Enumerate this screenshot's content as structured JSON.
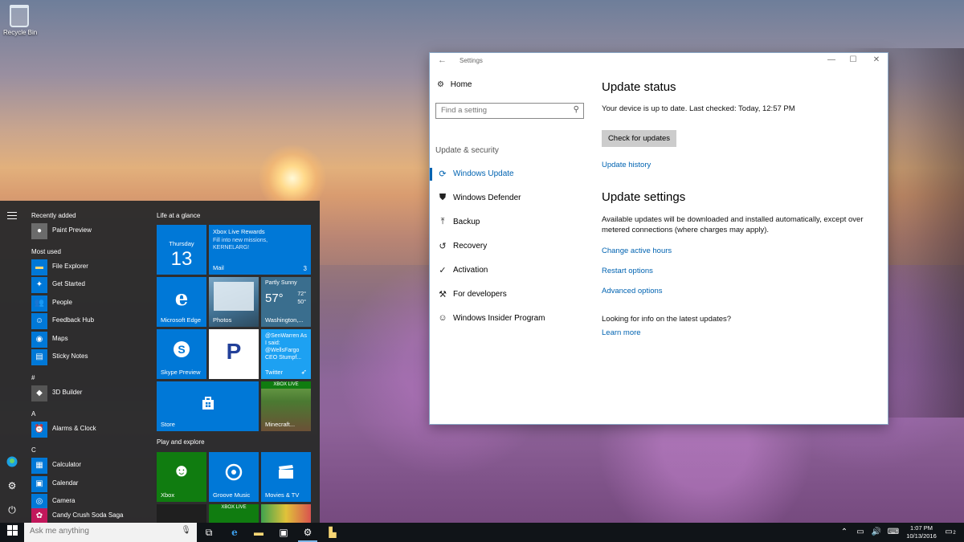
{
  "desktop": {
    "recycle_bin_label": "Recycle Bin"
  },
  "start_menu": {
    "recently_added_header": "Recently added",
    "recently_added": [
      {
        "name": "Paint Preview",
        "icon": "paint-icon"
      }
    ],
    "most_used_header": "Most used",
    "most_used": [
      {
        "name": "File Explorer",
        "icon": "folder-icon"
      },
      {
        "name": "Get Started",
        "icon": "lightbulb-icon"
      },
      {
        "name": "People",
        "icon": "people-icon"
      },
      {
        "name": "Feedback Hub",
        "icon": "feedback-icon"
      },
      {
        "name": "Maps",
        "icon": "map-icon"
      },
      {
        "name": "Sticky Notes",
        "icon": "note-icon"
      }
    ],
    "sections": [
      {
        "letter": "#",
        "apps": [
          {
            "name": "3D Builder",
            "icon": "cube-icon"
          }
        ]
      },
      {
        "letter": "A",
        "apps": [
          {
            "name": "Alarms & Clock",
            "icon": "alarm-icon"
          }
        ]
      },
      {
        "letter": "C",
        "apps": [
          {
            "name": "Calculator",
            "icon": "calculator-icon"
          },
          {
            "name": "Calendar",
            "icon": "calendar-icon"
          },
          {
            "name": "Camera",
            "icon": "camera-icon"
          },
          {
            "name": "Candy Crush Soda Saga",
            "icon": "candy-icon"
          }
        ]
      }
    ],
    "group_life": "Life at a glance",
    "group_play": "Play and explore",
    "tiles": {
      "calendar_day": "Thursday",
      "calendar_date": "13",
      "mail_title": "Xbox Live Rewards",
      "mail_body": "Fill into new missions, KERNELARG!",
      "mail_label": "Mail",
      "mail_count": "3",
      "edge_label": "Microsoft Edge",
      "photos_label": "Photos",
      "weather_cond": "Partly Sunny",
      "weather_temp": "57°",
      "weather_high": "72°",
      "weather_low": "50°",
      "weather_city": "Washington,...",
      "twitter_text": "@SenWarren As I said: @WellsFargo CEO Stumpf...",
      "twitter_label": "Twitter",
      "skype_label": "Skype Preview",
      "store_label": "Store",
      "minecraft_label": "Minecraft...",
      "xbox_live_badge": "XBOX LIVE",
      "xbox_label": "Xbox",
      "groove_label": "Groove Music",
      "movies_label": "Movies & TV"
    }
  },
  "settings": {
    "window_title": "Settings",
    "home": "Home",
    "search_placeholder": "Find a setting",
    "group_label": "Update & security",
    "nav": [
      {
        "label": "Windows Update",
        "icon": "refresh-icon",
        "active": true
      },
      {
        "label": "Windows Defender",
        "icon": "shield-icon",
        "active": false
      },
      {
        "label": "Backup",
        "icon": "backup-arrow-icon",
        "active": false
      },
      {
        "label": "Recovery",
        "icon": "history-icon",
        "active": false
      },
      {
        "label": "Activation",
        "icon": "check-circle-icon",
        "active": false
      },
      {
        "label": "For developers",
        "icon": "developer-icon",
        "active": false
      },
      {
        "label": "Windows Insider Program",
        "icon": "person-icon",
        "active": false
      }
    ],
    "update_status_heading": "Update status",
    "status_text": "Your device is up to date. Last checked: Today, 12:57 PM",
    "check_button": "Check for updates",
    "update_history_link": "Update history",
    "update_settings_heading": "Update settings",
    "settings_text": "Available updates will be downloaded and installed automatically, except over metered connections (where charges may apply).",
    "change_active_hours": "Change active hours",
    "restart_options": "Restart options",
    "advanced_options": "Advanced options",
    "info_question": "Looking for info on the latest updates?",
    "learn_more": "Learn more"
  },
  "taskbar": {
    "search_placeholder": "Ask me anything",
    "time": "1:07 PM",
    "date": "10/13/2016",
    "notification_count": "2"
  }
}
